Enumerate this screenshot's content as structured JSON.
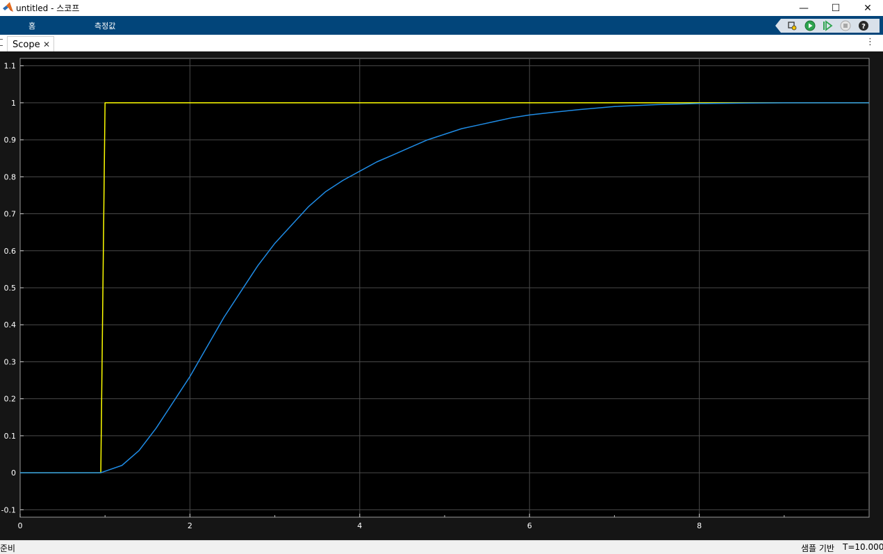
{
  "window": {
    "title": "untitled - 스코프",
    "minimize_glyph": "—",
    "maximize_glyph": "☐",
    "close_glyph": "✕"
  },
  "ribbon": {
    "tabs": [
      "홈",
      "측정값"
    ],
    "tools": [
      "highlight-simulink-block-icon",
      "run-icon",
      "step-forward-icon",
      "stop-icon",
      "help-icon"
    ]
  },
  "doc_tabs": {
    "label": "Scope",
    "close_glyph": "✕",
    "menu_glyph": "⋮"
  },
  "status": {
    "left": "준비",
    "mid": "샘플 기반",
    "right": "T=10.0000"
  },
  "colors": {
    "plot_bg": "#151515",
    "axes_bg": "#000000",
    "grid": "#4a4a4a",
    "tick_text": "#ffffff",
    "ribbon": "#02457a",
    "signal1": "#ffff00",
    "signal2": "#1f8ce6"
  },
  "chart_data": {
    "type": "line",
    "title": "",
    "xlabel": "",
    "ylabel": "",
    "xlim": [
      0,
      10
    ],
    "ylim": [
      -0.12,
      1.12
    ],
    "xticks": [
      0,
      2,
      4,
      6,
      8
    ],
    "yticks": [
      -0.1,
      0,
      0.1,
      0.2,
      0.3,
      0.4,
      0.5,
      0.6,
      0.7,
      0.8,
      0.9,
      1,
      1.1
    ],
    "ytick_labels": [
      "-0.1",
      "0",
      "0.1",
      "0.2",
      "0.3",
      "0.4",
      "0.5",
      "0.6",
      "0.7",
      "0.8",
      "0.9",
      "1",
      "1.1"
    ],
    "minor_xticks": [
      1,
      3,
      5,
      7,
      9
    ],
    "grid": true,
    "legend": "none",
    "series": [
      {
        "color": "#ffff00",
        "x": [
          0,
          0.95,
          1.0,
          10
        ],
        "y": [
          0,
          0,
          1,
          1
        ]
      },
      {
        "color": "#1f8ce6",
        "x": [
          0,
          0.95,
          1.2,
          1.4,
          1.6,
          1.8,
          2.0,
          2.2,
          2.4,
          2.6,
          2.8,
          3.0,
          3.2,
          3.4,
          3.6,
          3.8,
          4.0,
          4.2,
          4.4,
          4.6,
          4.8,
          5.0,
          5.2,
          5.4,
          5.6,
          5.8,
          6.0,
          6.3,
          6.6,
          7.0,
          7.5,
          8.0,
          8.5,
          9.0,
          10.0
        ],
        "y": [
          0,
          0,
          0.02,
          0.06,
          0.12,
          0.19,
          0.26,
          0.34,
          0.42,
          0.49,
          0.56,
          0.62,
          0.67,
          0.72,
          0.76,
          0.79,
          0.815,
          0.84,
          0.86,
          0.88,
          0.9,
          0.915,
          0.93,
          0.94,
          0.95,
          0.96,
          0.967,
          0.975,
          0.982,
          0.99,
          0.995,
          0.998,
          0.999,
          1.0,
          1.0
        ]
      }
    ]
  }
}
